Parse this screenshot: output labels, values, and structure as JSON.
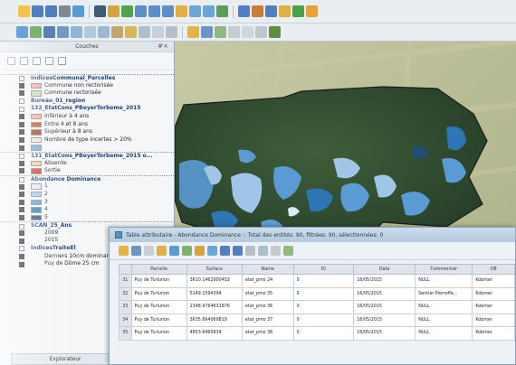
{
  "toolbar_icons": {
    "row1": [
      {
        "name": "new-project-icon",
        "color": "#f2c14e"
      },
      {
        "name": "save-icon",
        "color": "#4f7fc0"
      },
      {
        "name": "save-as-icon",
        "color": "#4f7fc0"
      },
      {
        "name": "print-icon",
        "color": "#7f8a94"
      },
      {
        "name": "zoom-icon",
        "color": "#5a9bd5"
      },
      {
        "sep": true
      },
      {
        "name": "pan-icon",
        "color": "#3f5a75"
      },
      {
        "name": "select-icon",
        "color": "#d7a43b"
      },
      {
        "name": "identify-icon",
        "color": "#4ea34e"
      },
      {
        "name": "zoom-in-icon",
        "color": "#5a8fc9"
      },
      {
        "name": "zoom-out-icon",
        "color": "#5a8fc9"
      },
      {
        "name": "zoom-full-icon",
        "color": "#5a8fc9"
      },
      {
        "name": "zoom-layer-icon",
        "color": "#e0b040"
      },
      {
        "name": "zoom-last-icon",
        "color": "#6aa7d8"
      },
      {
        "name": "zoom-next-icon",
        "color": "#6aa7d8"
      },
      {
        "name": "refresh-icon",
        "color": "#5b9e5b"
      },
      {
        "sep": true
      },
      {
        "name": "identify-features-icon",
        "color": "#4f7fc0"
      },
      {
        "name": "measure-icon",
        "color": "#c77d3a"
      },
      {
        "name": "select-features-icon",
        "color": "#4f7fc0"
      },
      {
        "name": "deselect-icon",
        "color": "#e0b040"
      },
      {
        "name": "python-icon",
        "color": "#46a447"
      },
      {
        "name": "plugin-icon",
        "color": "#e6a23c"
      }
    ],
    "row2": [
      {
        "name": "add-vector-icon",
        "color": "#6aa0d4"
      },
      {
        "name": "add-raster-icon",
        "color": "#7db36d"
      },
      {
        "name": "add-postgis-icon",
        "color": "#5b80b2"
      },
      {
        "name": "add-spatialite-icon",
        "color": "#6d9bc3"
      },
      {
        "name": "add-wms-icon",
        "color": "#8fb5d6"
      },
      {
        "name": "add-wcs-icon",
        "color": "#b1c7da"
      },
      {
        "name": "add-wfs-icon",
        "color": "#9eb9cf"
      },
      {
        "name": "add-csv-icon",
        "color": "#c3a46a"
      },
      {
        "name": "new-layer-icon",
        "color": "#d9b659"
      },
      {
        "name": "new-temp-layer-icon",
        "color": "#aebfcc"
      },
      {
        "name": "remove-layer-icon",
        "color": "#c9cfd4"
      },
      {
        "name": "add-delimited-icon",
        "color": "#b3c0ca"
      },
      {
        "sep": true
      },
      {
        "name": "toggle-edit-icon",
        "color": "#e2b441"
      },
      {
        "name": "save-edits-icon",
        "color": "#6c94c4"
      },
      {
        "name": "add-feature-icon",
        "color": "#91b87d"
      },
      {
        "name": "move-feature-icon",
        "color": "#c4cbd1"
      },
      {
        "name": "node-tool-icon",
        "color": "#d0d6db"
      },
      {
        "name": "delete-selected-icon",
        "color": "#bfc7ce"
      },
      {
        "name": "label-icon",
        "color": "#5c8f3f"
      }
    ]
  },
  "layers_panel": {
    "title": "Couches",
    "close": "#×",
    "footer": "Explorateur"
  },
  "layer_tree": [
    {
      "type": "group",
      "text": "IndicesCommunal_Parcelles",
      "sep": true
    },
    {
      "type": "item",
      "text": "Commune non rectorisée",
      "color": "#f2a6a6"
    },
    {
      "type": "item",
      "text": "Commune rectorisée",
      "color": "#c9ddb0"
    },
    {
      "type": "group",
      "text": "Bureau_01_region"
    },
    {
      "type": "group",
      "text": "132_EtatCons_PBeyerTorbeme_2015"
    },
    {
      "type": "item",
      "text": "Inférieur à 4 ans",
      "color": "#f4b183"
    },
    {
      "type": "item",
      "text": "Entre 4 et 8 ans",
      "color": "#c55a11"
    },
    {
      "type": "item",
      "text": "Supérieur à 8 ans",
      "color": "#9a3d12"
    },
    {
      "type": "item",
      "text": "Nombre de type incertes > 20%",
      "color": "#fce4d6"
    },
    {
      "type": "item",
      "text": "",
      "color": "#6fa8dc"
    },
    {
      "type": "group",
      "text": "131_EtatCons_PBeyerTorbeme_2015 o...",
      "sep": true
    },
    {
      "type": "item",
      "text": "Absente",
      "color": "#f6c4a0"
    },
    {
      "type": "item",
      "text": "Sortie",
      "color": "#d9302a"
    },
    {
      "type": "group",
      "text": "Abondance Dominance",
      "sep": true
    },
    {
      "type": "item",
      "text": "1",
      "color": "#dce9f6"
    },
    {
      "type": "item",
      "text": "2",
      "color": "#9fc5e8"
    },
    {
      "type": "item",
      "text": "3",
      "color": "#5b9bd5"
    },
    {
      "type": "item",
      "text": "4",
      "color": "#2e75b6"
    },
    {
      "type": "item",
      "text": "5",
      "color": "#1f4e79"
    },
    {
      "type": "group",
      "text": "SCAN_25_Ans",
      "sep": true
    },
    {
      "type": "item",
      "text": "2009"
    },
    {
      "type": "item",
      "text": "2015"
    },
    {
      "type": "group",
      "text": "IndicesTraiteEl"
    },
    {
      "type": "item",
      "text": "Derniers 10cm dominant..."
    },
    {
      "type": "item",
      "text": "Puy de Dôme 25 cm"
    }
  ],
  "attribute_table": {
    "title": "Table attributaire - Abondance Dominance :: Total des entités: 90, filtrées: 90, sélectionnées: 0",
    "toolbar_icons": [
      {
        "name": "edit-mode-icon",
        "color": "#e2b441"
      },
      {
        "name": "save-edits-icon",
        "color": "#6c94c4"
      },
      {
        "name": "delete-feature-icon",
        "color": "#c9cfd4"
      },
      {
        "name": "select-expression-icon",
        "color": "#e0b040"
      },
      {
        "name": "select-all-icon",
        "color": "#5a9bd5"
      },
      {
        "name": "invert-selection-icon",
        "color": "#7fb36d"
      },
      {
        "name": "deselect-all-icon",
        "color": "#d7a43b"
      },
      {
        "name": "move-selection-top-icon",
        "color": "#6aa7d8"
      },
      {
        "name": "pan-to-selection-icon",
        "color": "#4f7fc0"
      },
      {
        "name": "zoom-to-selection-icon",
        "color": "#4f7fc0"
      },
      {
        "name": "copy-rows-icon",
        "color": "#b3c0ca"
      },
      {
        "name": "new-field-icon",
        "color": "#aebfcc"
      },
      {
        "name": "delete-field-icon",
        "color": "#c4cbd1"
      },
      {
        "name": "field-calculator-icon",
        "color": "#91b87d"
      }
    ],
    "columns": [
      "Parcelle",
      "Surface",
      "Name",
      "ID",
      "Date",
      "Commentair",
      "OB"
    ],
    "rows": [
      {
        "n": "31",
        "cells": [
          "Puy de Turlurion",
          "3610.14629004S3",
          "etat_pmo 24",
          "0",
          "16/05/2015",
          "NULL",
          "Kobmer"
        ]
      },
      {
        "n": "32",
        "cells": [
          "Puy de Turlurion",
          "5149.1594394",
          "etat_pmo 35",
          "0",
          "16/05/2015",
          "Sentier Pierreffe...",
          "Kobmer"
        ]
      },
      {
        "n": "33",
        "cells": [
          "Puy de Turlurion",
          "2348.9764631876",
          "etat_pmo 36",
          "0",
          "16/05/2015",
          "NULL",
          "Kobmer"
        ]
      },
      {
        "n": "34",
        "cells": [
          "Puy de Turlurion",
          "3635.664069819",
          "etat_pmo 37",
          "0",
          "16/05/2015",
          "NULL",
          "Kobmer"
        ]
      },
      {
        "n": "35",
        "cells": [
          "Puy de Turlurion",
          "4853.6460934",
          "etat_pmo 38",
          "0",
          "16/05/2015",
          "NULL",
          "Kobmer"
        ]
      }
    ]
  }
}
